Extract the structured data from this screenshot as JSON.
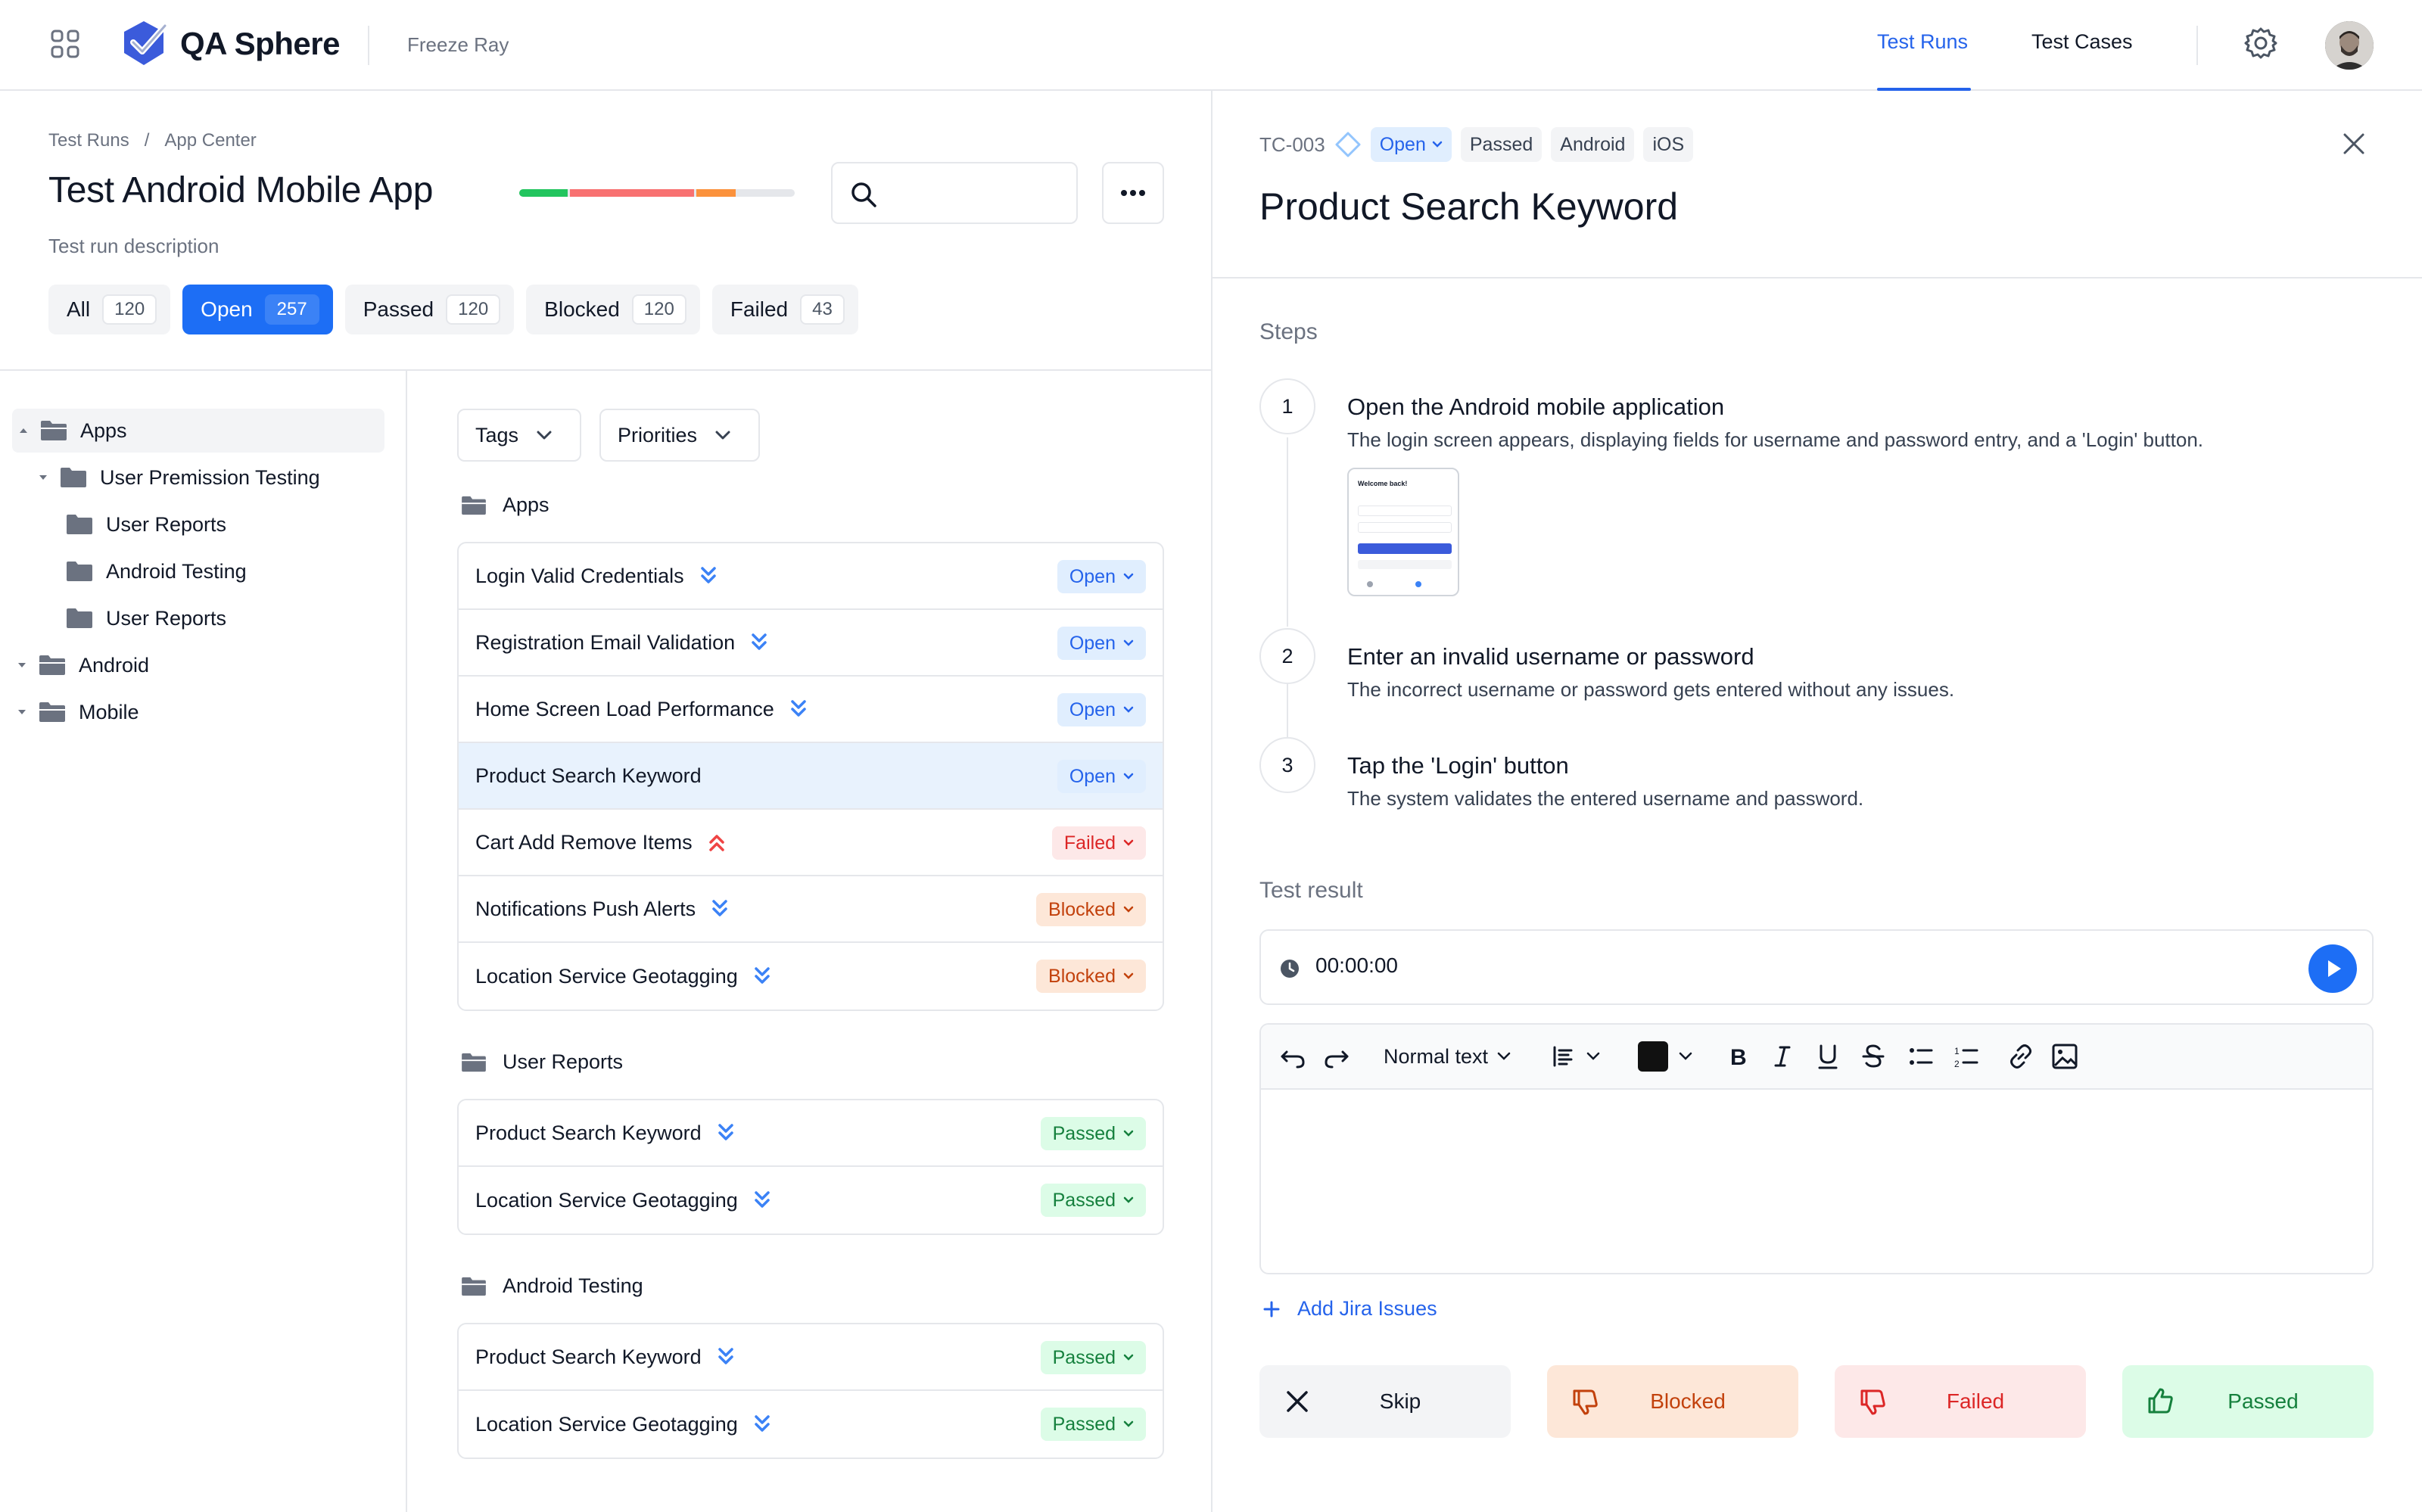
{
  "app": {
    "name": "QA Sphere",
    "project": "Freeze Ray",
    "nav_tabs": [
      "Test Runs",
      "Test Cases"
    ],
    "active_tab": "Test Runs"
  },
  "run": {
    "breadcrumb": [
      "Test Runs",
      "App Center"
    ],
    "breadcrumb_sep": "/",
    "title": "Test Android Mobile App",
    "description": "Test run description",
    "progress_colors": [
      "#22c55e",
      "#f87171",
      "#fb923c",
      "#e5e7eb"
    ],
    "search_value": "",
    "filters": [
      {
        "label": "All",
        "count": "120"
      },
      {
        "label": "Open",
        "count": "257"
      },
      {
        "label": "Passed",
        "count": "120"
      },
      {
        "label": "Blocked",
        "count": "120"
      },
      {
        "label": "Failed",
        "count": "43"
      }
    ],
    "active_filter": "Open"
  },
  "tree": [
    {
      "label": "Apps",
      "expanded": true
    },
    {
      "label": "User Premission Testing",
      "expanded": true
    },
    {
      "label": "User Reports"
    },
    {
      "label": "Android Testing"
    },
    {
      "label": "User Reports"
    },
    {
      "label": "Android",
      "expanded": true
    },
    {
      "label": "Mobile",
      "expanded": true
    }
  ],
  "list_filters": {
    "tags": "Tags",
    "priorities": "Priorities"
  },
  "groups": [
    {
      "title": "Apps",
      "cases": [
        {
          "name": "Login Valid Credentials",
          "priority": "low",
          "status": "Open"
        },
        {
          "name": "Registration Email Validation",
          "priority": "low",
          "status": "Open"
        },
        {
          "name": "Home Screen Load Performance",
          "priority": "low",
          "status": "Open"
        },
        {
          "name": "Product Search Keyword",
          "priority": "none",
          "status": "Open"
        },
        {
          "name": "Cart Add Remove Items",
          "priority": "high",
          "status": "Failed"
        },
        {
          "name": "Notifications Push Alerts",
          "priority": "low",
          "status": "Blocked"
        },
        {
          "name": "Location Service Geotagging",
          "priority": "low",
          "status": "Blocked"
        }
      ]
    },
    {
      "title": "User Reports",
      "cases": [
        {
          "name": "Product Search Keyword",
          "priority": "low",
          "status": "Passed"
        },
        {
          "name": "Location Service Geotagging",
          "priority": "low",
          "status": "Passed"
        }
      ]
    },
    {
      "title": "Android Testing",
      "cases": [
        {
          "name": "Product Search Keyword",
          "priority": "low",
          "status": "Passed"
        },
        {
          "name": "Location Service Geotagging",
          "priority": "low",
          "status": "Passed"
        }
      ]
    }
  ],
  "detail": {
    "id": "TC-003",
    "status": "Open",
    "tags": [
      "Passed",
      "Android",
      "iOS"
    ],
    "title": "Product Search Keyword",
    "steps_label": "Steps",
    "steps": [
      {
        "num": "1",
        "title": "Open the Android mobile application",
        "desc": "The login screen appears, displaying fields for username and password entry, and a 'Login' button."
      },
      {
        "num": "2",
        "title": "Enter an invalid username or password",
        "desc": "The incorrect username or password gets entered without any issues."
      },
      {
        "num": "3",
        "title": "Tap the 'Login' button",
        "desc": "The system validates the entered username and password."
      }
    ],
    "thumbnail_text": "Welcome back!",
    "result_label": "Test result",
    "timer": "00:00:00",
    "text_style": "Normal text",
    "text_color": "#111111",
    "jira_link": "Add Jira Issues",
    "actions": [
      {
        "label": "Skip",
        "icon": "close-icon"
      },
      {
        "label": "Blocked",
        "icon": "thumbs-down-icon"
      },
      {
        "label": "Failed",
        "icon": "thumbs-down-icon"
      },
      {
        "label": "Passed",
        "icon": "thumbs-up-icon"
      }
    ]
  },
  "colors": {
    "accent": "#2563eb",
    "open": "#2563eb",
    "failed": "#dc2626",
    "blocked": "#c2410c",
    "passed": "#15803d"
  }
}
